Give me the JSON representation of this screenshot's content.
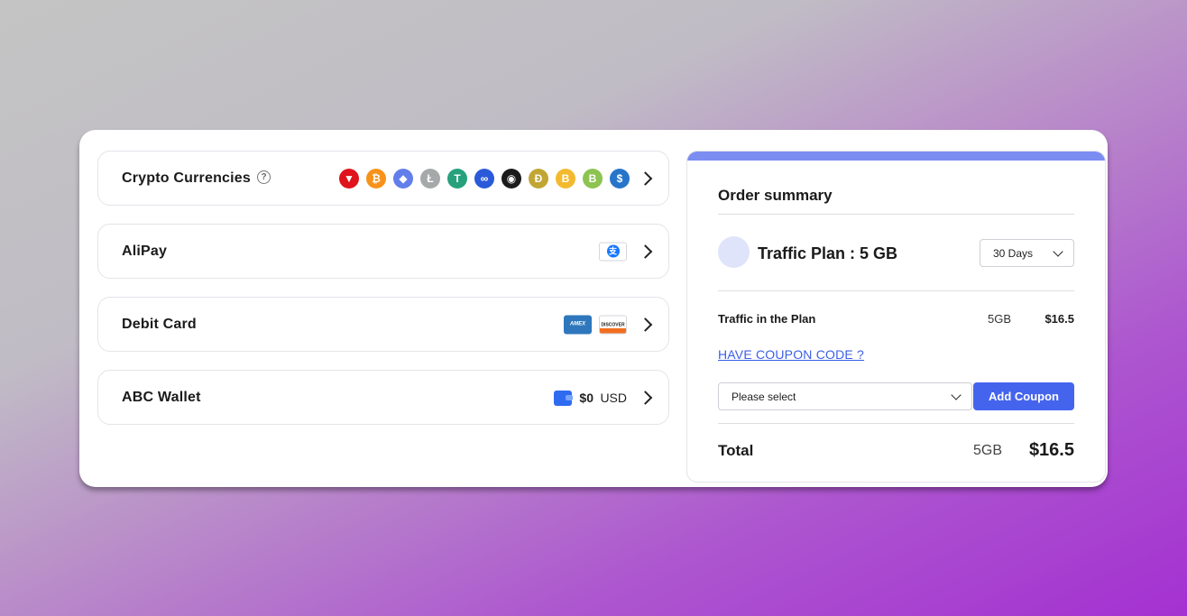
{
  "payment_methods": {
    "crypto": {
      "label": "Crypto Currencies",
      "help_icon": "?",
      "coins": [
        {
          "icon": "tron-icon",
          "glyph": "▼",
          "color": "#e0121b"
        },
        {
          "icon": "bitcoin-icon",
          "glyph": "₿",
          "color": "#f7931a"
        },
        {
          "icon": "ethereum-icon",
          "glyph": "◆",
          "color": "#627eea"
        },
        {
          "icon": "litecoin-icon",
          "glyph": "Ł",
          "color": "#a6a9aa"
        },
        {
          "icon": "tether-icon",
          "glyph": "T",
          "color": "#26a17b"
        },
        {
          "icon": "polygon-icon",
          "glyph": "∞",
          "color": "#2a5ada"
        },
        {
          "icon": "shiba-icon",
          "glyph": "◉",
          "color": "#1b1b1b"
        },
        {
          "icon": "dogecoin-icon",
          "glyph": "Ð",
          "color": "#c2a633"
        },
        {
          "icon": "bnb-icon",
          "glyph": "B",
          "color": "#f3ba2f"
        },
        {
          "icon": "bitcoin-cash-icon",
          "glyph": "B",
          "color": "#8dc351"
        },
        {
          "icon": "usdc-icon",
          "glyph": "$",
          "color": "#2775ca"
        }
      ]
    },
    "alipay": {
      "label": "AliPay",
      "logo_glyph": "支"
    },
    "debit": {
      "label": "Debit Card",
      "amex": "AMEX",
      "discover": "DISCOVER"
    },
    "wallet": {
      "label": "ABC Wallet",
      "amount": "$0",
      "currency": "USD"
    }
  },
  "summary": {
    "title": "Order summary",
    "plan_label": "Traffic Plan :",
    "plan_value": "5 GB",
    "duration": "30 Days",
    "row_label": "Traffic in the Plan",
    "row_gb": "5GB",
    "row_price": "$16.5",
    "coupon_link": "HAVE COUPON CODE ?",
    "coupon_placeholder": "Please select",
    "add_coupon": "Add Coupon",
    "total_label": "Total",
    "total_gb": "5GB",
    "total_price": "$16.5"
  },
  "colors": {
    "accent": "#4564ee",
    "summary_bar": "#7c8df2",
    "link": "#3c5ee8"
  }
}
